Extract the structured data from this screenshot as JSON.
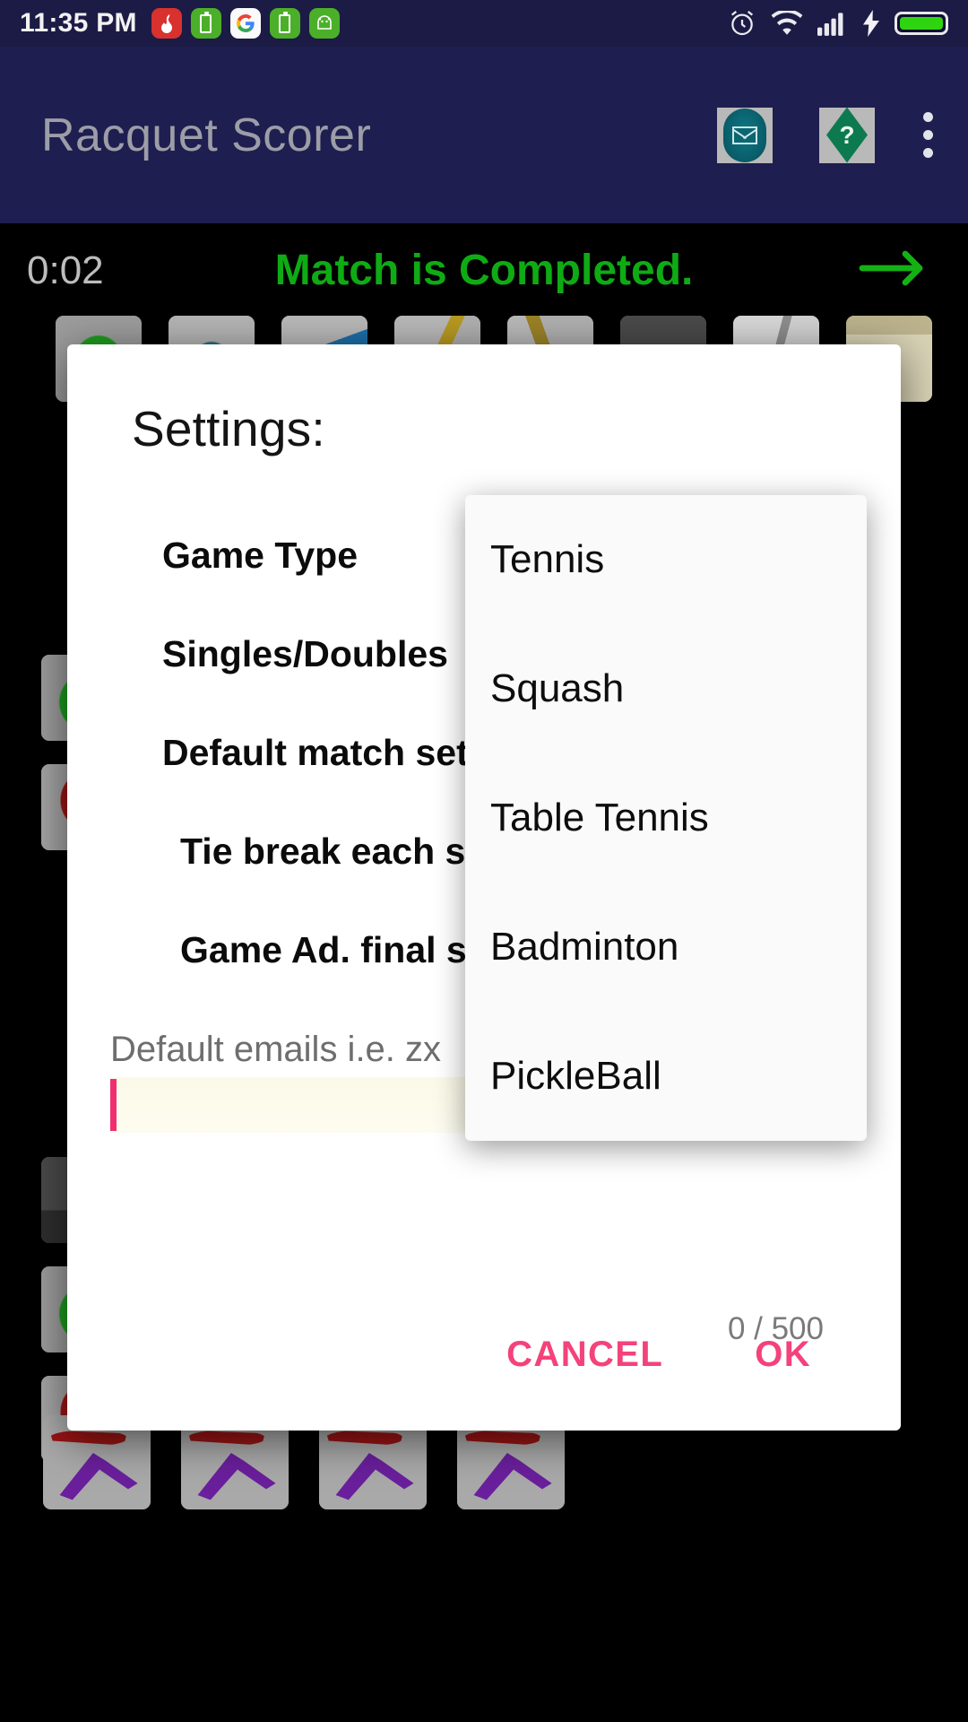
{
  "status_bar": {
    "clock": "11:35 PM",
    "notification_icons": [
      "app-badge-icon",
      "battery-saver-icon",
      "google-icon",
      "battery-saver-icon",
      "android-icon"
    ],
    "right_icons": [
      "alarm-icon",
      "wifi-icon",
      "signal-icon",
      "charging-bolt-icon",
      "battery-icon"
    ],
    "background_color": "#1b1b45"
  },
  "app_bar": {
    "title": "Racquet Scorer",
    "actions": [
      {
        "name": "email-action",
        "icon": "mail-icon"
      },
      {
        "name": "help-action",
        "icon": "help-diamond-icon",
        "glyph": "?"
      },
      {
        "name": "overflow-menu",
        "icon": "more-vert-icon"
      }
    ],
    "background_color": "#1e1e50",
    "title_color": "#9d9da8"
  },
  "match_bar": {
    "timer": "0:02",
    "status_text": "Match is Completed.",
    "status_color": "#0fab14",
    "next_arrow": "arrow-right-icon"
  },
  "dialog": {
    "title": "Settings:",
    "rows": [
      {
        "label": "Game Type",
        "indent": false
      },
      {
        "label": "Singles/Doubles",
        "indent": false
      },
      {
        "label": "Default match sets",
        "indent": false
      },
      {
        "label": "Tie break each set",
        "indent": true
      },
      {
        "label": "Game Ad. final set",
        "indent": true
      }
    ],
    "email_placeholder": "Default emails i.e. zx",
    "email_value": "",
    "char_counter": "0 / 500",
    "cancel_label": "CANCEL",
    "ok_label": "OK",
    "accent_color": "#f4427b"
  },
  "dropdown": {
    "name": "game-type-dropdown",
    "items": [
      "Tennis",
      "Squash",
      "Table Tennis",
      "Badminton",
      "PickleBall"
    ],
    "selected": "Tennis"
  },
  "background_tiles": {
    "row_top": [
      "g-green",
      "g-teal",
      "g-blue",
      "g-yellow",
      "g-wheat",
      "g-dark",
      "g-paper",
      "g-clip"
    ],
    "row_mid": [
      "g-green",
      "g-red"
    ],
    "row_low": [
      "g-dark",
      "g-green",
      "g-red"
    ],
    "row_bottom": [
      "g-runner",
      "g-runner",
      "g-runner",
      "g-runner"
    ]
  }
}
